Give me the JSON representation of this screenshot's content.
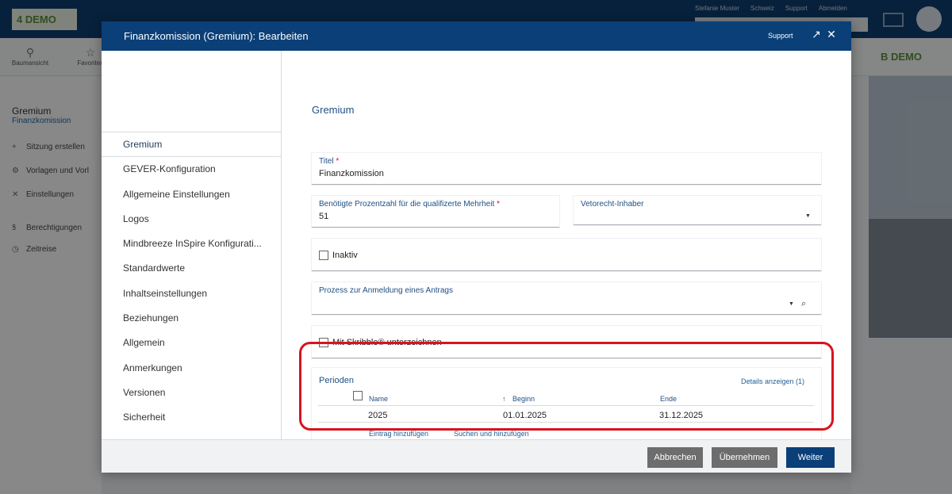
{
  "background": {
    "logo": "4 DEMO",
    "top_links": [
      "Stefanie Muster",
      "Schweiz",
      "Support",
      "Abmelden"
    ],
    "toolbar": [
      {
        "icon": "tree-icon",
        "label": "Baumansicht"
      },
      {
        "icon": "star-icon",
        "label": "Favoriten"
      }
    ],
    "right_logo": "B DEMO",
    "section_title": "Gremium",
    "section_subtitle": "Finanzkomission",
    "nav": [
      {
        "icon": "plus-icon",
        "label": "Sitzung erstellen"
      },
      {
        "icon": "gear-icon",
        "label": "Vorlagen und Vorl"
      },
      {
        "icon": "tools-icon",
        "label": "Einstellungen"
      },
      {
        "icon": "users-icon",
        "label": "Berechtigungen"
      },
      {
        "icon": "clock-icon",
        "label": "Zeitreise"
      }
    ]
  },
  "modal": {
    "title": "Finanzkomission (Gremium): Bearbeiten",
    "support": "Support",
    "sidebar": [
      {
        "label": "Gremium",
        "active": true
      },
      {
        "label": "GEVER-Konfiguration"
      },
      {
        "label": "Allgemeine Einstellungen"
      },
      {
        "label": "Logos"
      },
      {
        "label": "Mindbreeze InSpire Konfigurati..."
      },
      {
        "label": "Standardwerte"
      },
      {
        "label": "Inhaltseinstellungen"
      },
      {
        "label": "Beziehungen"
      },
      {
        "label": "Allgemein"
      },
      {
        "label": "Anmerkungen"
      },
      {
        "label": "Versionen"
      },
      {
        "label": "Sicherheit"
      }
    ],
    "section_title": "Gremium",
    "fields": {
      "titel": {
        "label": "Titel",
        "required": "*",
        "value": "Finanzkomission"
      },
      "prozent": {
        "label": "Benötigte Prozentzahl für die qualifizerte Mehrheit",
        "required": "*",
        "value": "51"
      },
      "veto": {
        "label": "Vetorecht-Inhaber",
        "value": ""
      },
      "inaktiv": {
        "label": "Inaktiv",
        "checked": false
      },
      "prozess": {
        "label": "Prozess zur Anmeldung eines Antrags",
        "value": ""
      },
      "skribble": {
        "label": "Mit Skribble® unterzeichnen",
        "checked": false
      }
    },
    "perioden": {
      "label": "Perioden",
      "details": "Details anzeigen (1)",
      "columns": {
        "name": "Name",
        "beginn": "Beginn",
        "ende": "Ende"
      },
      "sort_icon": "↑",
      "rows": [
        {
          "name": "2025",
          "beginn": "01.01.2025",
          "ende": "31.12.2025"
        }
      ],
      "add_entry": "Eintrag hinzufügen",
      "search_add": "Suchen und hinzufügen"
    },
    "buttons": {
      "cancel": "Abbrechen",
      "apply": "Übernehmen",
      "next": "Weiter"
    }
  }
}
